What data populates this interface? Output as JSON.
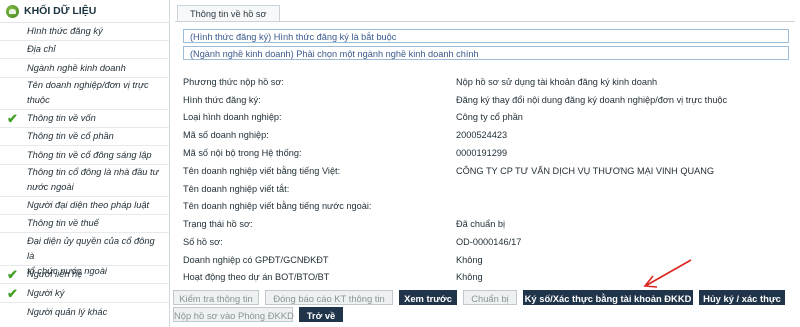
{
  "sidebar": {
    "title": "KHỐI DỮ LIỆU",
    "items": [
      {
        "label": "Hình thức đăng ký",
        "checked": false
      },
      {
        "label": "Địa chỉ",
        "checked": false
      },
      {
        "label": "Ngành nghề kinh doanh",
        "checked": false
      },
      {
        "label_line1": "Tên doanh nghiệp/đơn vị trực",
        "label_line2": "thuộc",
        "checked": false
      },
      {
        "label": "Thông tin về vốn",
        "checked": true
      },
      {
        "label": "Thông tin về cổ phần",
        "checked": false
      },
      {
        "label": "Thông tin về cổ đông sáng lập",
        "checked": false
      },
      {
        "label_line1": "Thông tin cổ đông là nhà đầu tư",
        "label_line2": "nước ngoài",
        "checked": false
      },
      {
        "label": "Người đại diện theo pháp luật",
        "checked": false
      },
      {
        "label": "Thông tin về thuế",
        "checked": false
      },
      {
        "label_line1": "Đại diện ủy quyền của cổ đông là",
        "label_line2": "tổ chức nước ngoài",
        "checked": false
      },
      {
        "label": "Người liên hệ",
        "checked": true
      },
      {
        "label": "Người ký",
        "checked": true
      },
      {
        "label": "Người quản lý khác",
        "checked": false
      }
    ]
  },
  "main": {
    "tab": "Thông tin về hồ sơ",
    "messages": [
      "(Hình thức đăng ký) Hình thức đăng ký là bắt buộc",
      "(Ngành nghề kinh doanh) Phải chọn một ngành nghề kinh doanh chính"
    ],
    "fields": [
      {
        "label": "Phương thức nộp hồ sơ:",
        "value": "Nộp hồ sơ sử dụng tài khoản đăng ký kinh doanh"
      },
      {
        "label": "Hình thức đăng ký:",
        "value": "Đăng ký thay đổi nội dung đăng ký doanh nghiệp/đơn vị trực thuộc"
      },
      {
        "label": "Loại hình doanh nghiệp:",
        "value": "Công ty cổ phần"
      },
      {
        "label": "Mã số doanh nghiệp:",
        "value": "2000524423"
      },
      {
        "label": "Mã số nội bộ trong Hệ thống:",
        "value": "0000191299"
      },
      {
        "label": "Tên doanh nghiệp viết bằng tiếng Việt:",
        "value": "CÔNG TY CP TƯ VẤN DỊCH VỤ THƯƠNG MẠI VINH QUANG"
      },
      {
        "label": "Tên doanh nghiệp viết tắt:",
        "value": ""
      },
      {
        "label": "Tên doanh nghiệp viết bằng tiếng nước ngoài:",
        "value": ""
      },
      {
        "label": "Trạng thái hồ sơ:",
        "value": "Đã chuẩn bị"
      },
      {
        "label": "Số hồ sơ:",
        "value": "OD-0000146/17"
      },
      {
        "label": "Doanh nghiệp có GPĐT/GCNĐKĐT",
        "value": "Không"
      },
      {
        "label": "Hoạt động theo dự án BOT/BTO/BT",
        "value": "Không"
      }
    ],
    "buttons": {
      "check_info": "Kiểm tra thông tin",
      "report_kt": "Đóng báo cáo KT thông tin",
      "preview": "Xem trước",
      "prepare": "Chuẩn bị",
      "sign": "Ký số/Xác thực bằng tài khoản ĐKKD",
      "cancel_sign": "Hủy ký / xác thực",
      "submit": "Nộp hồ sơ vào Phòng ĐKKD",
      "back": "Trở về"
    }
  },
  "colors": {
    "accent_dark": "#20344a",
    "check_green": "#46a12a",
    "annotation_arrow": "#d9251c"
  }
}
